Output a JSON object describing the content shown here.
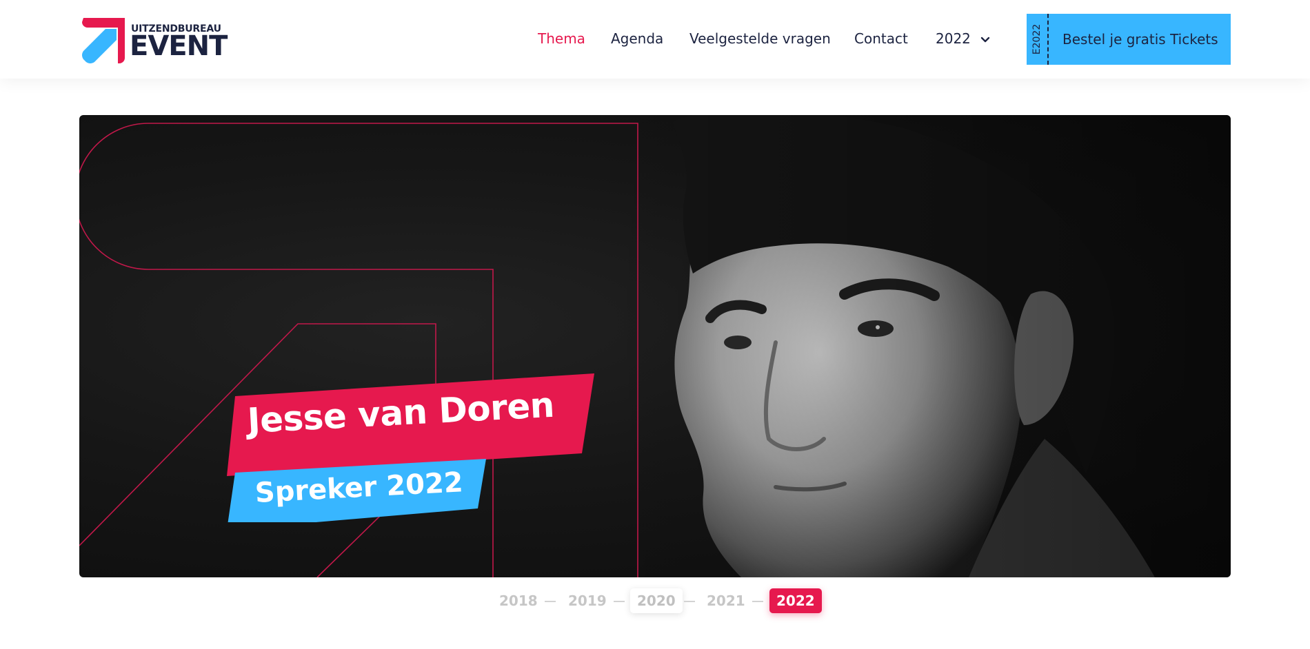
{
  "brand": {
    "small": "UITZENDBUREAU",
    "big": "EVENT",
    "colors": {
      "navy": "#1c2340",
      "pink": "#e6194e",
      "blue": "#38b6ff"
    }
  },
  "nav": {
    "items": [
      {
        "label": "Thema",
        "active": true
      },
      {
        "label": "Agenda",
        "active": false
      },
      {
        "label": "Veelgestelde vragen",
        "active": false
      },
      {
        "label": "Contact",
        "active": false
      },
      {
        "label": "2022",
        "active": false,
        "icon": "chevron-down-icon"
      }
    ]
  },
  "tickets": {
    "stub": "E2022",
    "label": "Bestel je gratis Tickets"
  },
  "hero": {
    "name": "Jesse van Doren",
    "role": "Spreker 2022"
  },
  "years": {
    "items": [
      "2018",
      "2019",
      "2020",
      "2021",
      "2022"
    ],
    "selected": "2022",
    "hovered": "2020"
  }
}
